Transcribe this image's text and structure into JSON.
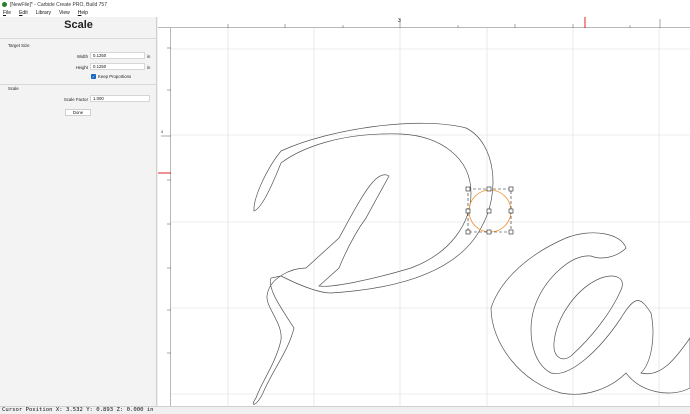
{
  "window": {
    "title": "[NewFile]* - Carbide Create PRO, Build 757"
  },
  "menu": {
    "items": [
      {
        "key": "F",
        "rest": "ile"
      },
      {
        "key": "E",
        "rest": "dit"
      },
      {
        "key": "",
        "rest": "Library"
      },
      {
        "key": "",
        "rest": "View"
      },
      {
        "key": "H",
        "rest": "elp"
      }
    ]
  },
  "panel": {
    "title": "Scale",
    "target_size": {
      "label": "Target Size",
      "width_label": "Width",
      "width_value": "0.1250",
      "height_label": "Height",
      "height_value": "0.1250",
      "unit": "in",
      "keep_proportions": "Keep Proportions",
      "keep_proportions_checked": true
    },
    "scale": {
      "label": "Scale",
      "factor_label": "Scale Factor",
      "factor_value": "1.000"
    },
    "done_label": "Done"
  },
  "canvas": {
    "ruler_top_label": "3",
    "ruler_left_label": "4",
    "selection_color": "#f08a24",
    "cursor_marker_color": "#e02020"
  },
  "status": {
    "text": "Cursor Position X: 3.532 Y: 0.893 Z: 0.000 in"
  }
}
